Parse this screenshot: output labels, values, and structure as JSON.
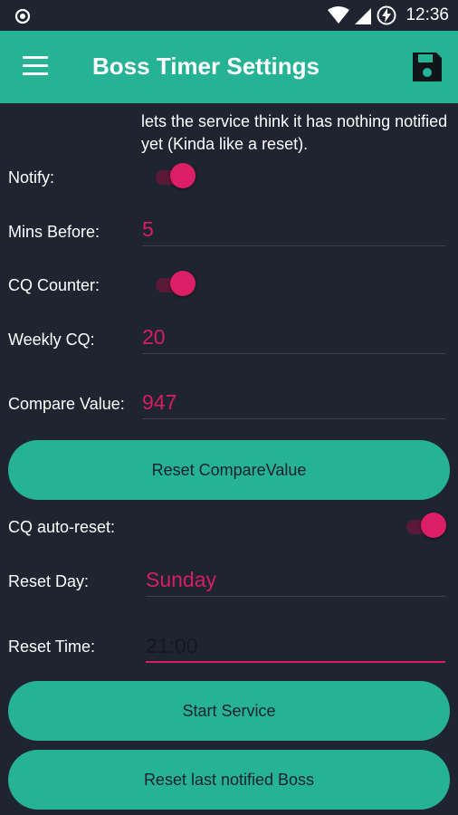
{
  "status_bar": {
    "time": "12:36"
  },
  "app_bar": {
    "title": "Boss Timer Settings"
  },
  "description": "lets the service think it has nothing notified yet (Kinda like a reset).",
  "settings": {
    "notify_label": "Notify:",
    "notify_on": true,
    "mins_before_label": "Mins Before:",
    "mins_before_value": "5",
    "cq_counter_label": "CQ Counter:",
    "cq_counter_on": true,
    "weekly_cq_label": "Weekly CQ:",
    "weekly_cq_value": "20",
    "compare_value_label": "Compare Value:",
    "compare_value": "947",
    "cq_auto_reset_label": "CQ auto-reset:",
    "cq_auto_reset_on": true,
    "reset_day_label": "Reset Day:",
    "reset_day_value": "Sunday",
    "reset_time_label": "Reset Time:",
    "reset_time_value": "21:00"
  },
  "buttons": {
    "reset_compare": "Reset CompareValue",
    "start_service": "Start Service",
    "reset_last_notified": "Reset last notified Boss"
  },
  "colors": {
    "accent": "#26b395",
    "pink": "#d81e60",
    "background": "#1e2430"
  }
}
